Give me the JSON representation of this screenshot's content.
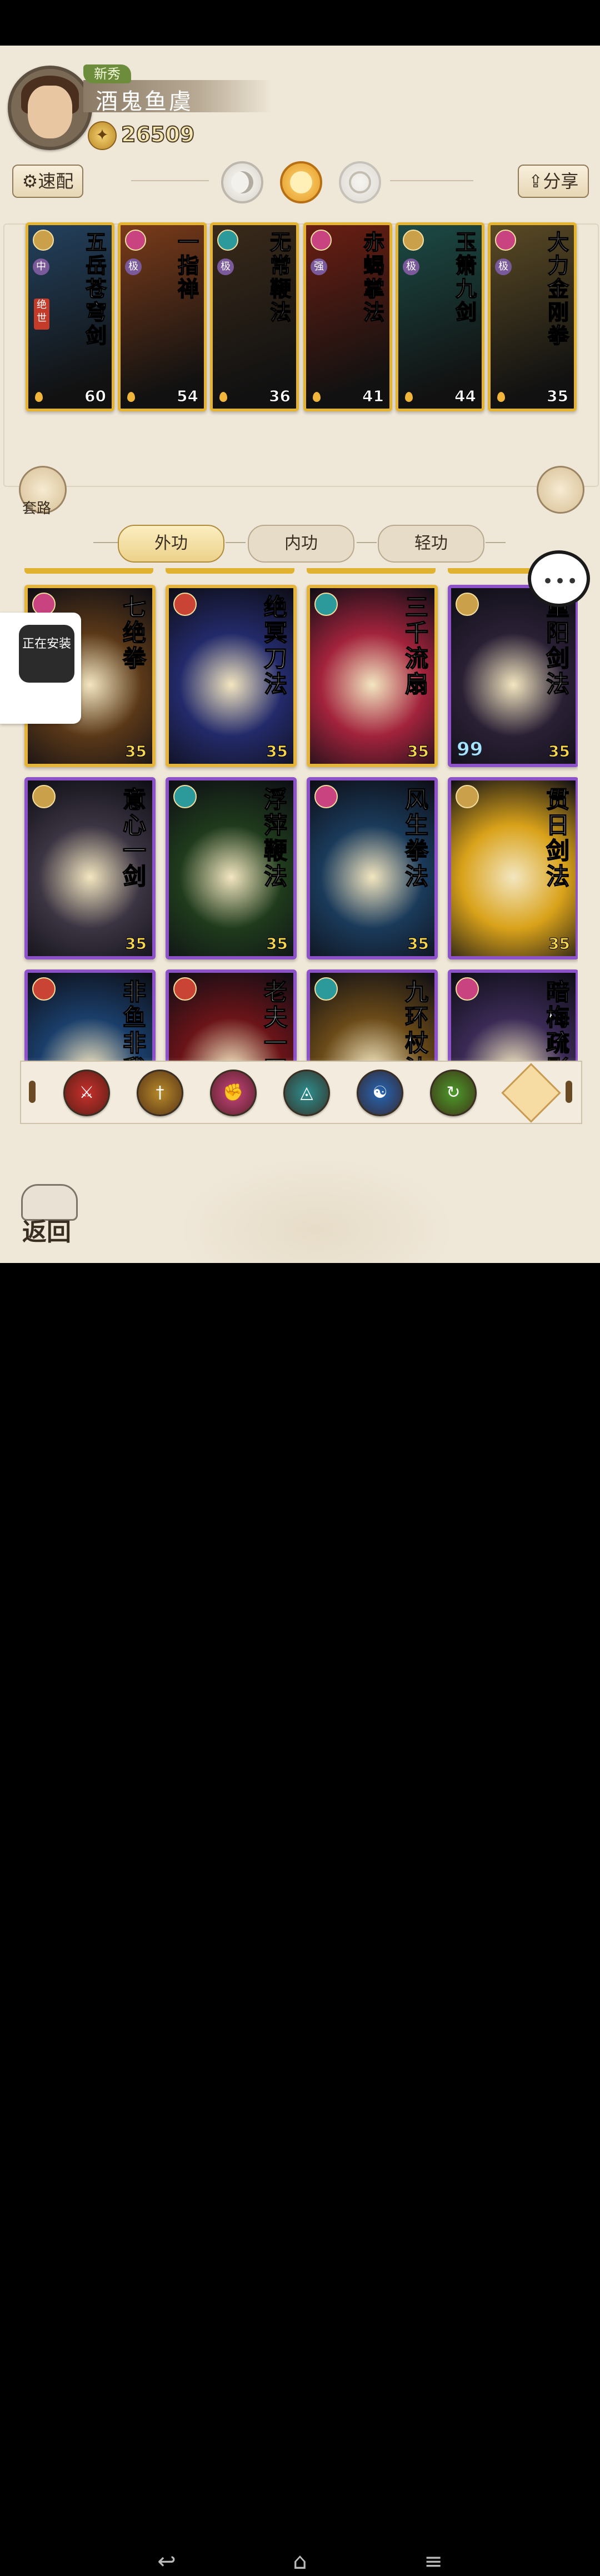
{
  "player": {
    "rank": "新秀",
    "name": "酒鬼鱼虞",
    "coins": "26509"
  },
  "buttons": {
    "quick_config": "速配",
    "share": "分享",
    "set_route": "套路",
    "back": "返回"
  },
  "equipped": [
    {
      "name": "五岳苍穹剑",
      "level": "60",
      "grade": "中",
      "tag": "绝世",
      "icon_color": "#caa14a",
      "bg": "#23415e"
    },
    {
      "name": "一指禅",
      "level": "54",
      "grade": "极",
      "icon_color": "#c8437f",
      "bg": "#7a3b1a"
    },
    {
      "name": "无常鞭法",
      "level": "36",
      "grade": "极",
      "icon_color": "#2c9a9a",
      "bg": "#3a2a1a"
    },
    {
      "name": "赤蝎掌法",
      "level": "41",
      "grade": "强",
      "icon_color": "#c8437f",
      "bg": "#6a1e12"
    },
    {
      "name": "玉箫九剑",
      "level": "44",
      "grade": "极",
      "icon_color": "#caa14a",
      "bg": "#1c4a45"
    },
    {
      "name": "大力金刚拳",
      "level": "35",
      "grade": "极",
      "icon_color": "#c8437f",
      "bg": "#5a4a25"
    }
  ],
  "tabs": [
    {
      "label": "外功",
      "active": true
    },
    {
      "label": "内功",
      "active": false
    },
    {
      "label": "轻功",
      "active": false
    }
  ],
  "chat_icon": "chat-bubble-icon",
  "installing": "正在安装",
  "skills": [
    {
      "name": "七绝拳",
      "level": "35",
      "frame": "gold",
      "icon_color": "#c8437f",
      "bg": "#5a3818"
    },
    {
      "name": "绝冥刀法",
      "level": "35",
      "frame": "gold",
      "icon_color": "#c94434",
      "bg": "#232a6a"
    },
    {
      "name": "三千流扇",
      "level": "35",
      "frame": "gold",
      "icon_color": "#2c9a9a",
      "bg": "#a2233c"
    },
    {
      "name": "重阳剑法",
      "level": "35",
      "frame": "purple",
      "icon_color": "#caa14a",
      "bg": "#2a2035",
      "count": "99"
    },
    {
      "name": "意心一剑",
      "level": "35",
      "frame": "purple",
      "icon_color": "#caa14a",
      "bg": "#3b3442"
    },
    {
      "name": "浮萍鞭法",
      "level": "35",
      "frame": "purple",
      "icon_color": "#2c9a9a",
      "bg": "#1f3b1c"
    },
    {
      "name": "风生拳法",
      "level": "35",
      "frame": "purple",
      "icon_color": "#c8437f",
      "bg": "#1a3a5a"
    },
    {
      "name": "贯日剑法",
      "level": "35",
      "frame": "purple",
      "icon_color": "#caa14a",
      "bg": "#d9a21a"
    },
    {
      "name": "非鱼非我",
      "level": "",
      "frame": "purple",
      "icon_color": "#c94434",
      "bg": "#1a3e6a"
    },
    {
      "name": "老夫一刀",
      "level": "",
      "frame": "purple",
      "icon_color": "#c94434",
      "bg": "#6a1418"
    },
    {
      "name": "九环杖法",
      "level": "",
      "frame": "purple",
      "icon_color": "#2c9a9a",
      "bg": "#6a4a18"
    },
    {
      "name": "暗梅疏影",
      "level": "",
      "frame": "purple",
      "icon_color": "#c8437f",
      "bg": "#3a2a55"
    }
  ],
  "filters": [
    {
      "name": "blade-filter-icon",
      "glyph": "⚔",
      "color": "#c9302c"
    },
    {
      "name": "sword-filter-icon",
      "glyph": "†",
      "color": "#b88a2a"
    },
    {
      "name": "fist-filter-icon",
      "glyph": "✊",
      "color": "#c8437f"
    },
    {
      "name": "fan-filter-icon",
      "glyph": "◬",
      "color": "#2c8f8f"
    },
    {
      "name": "taiji-filter-icon",
      "glyph": "☯",
      "color": "#2566b5"
    },
    {
      "name": "whip-filter-icon",
      "glyph": "↻",
      "color": "#4d9a2c"
    }
  ]
}
